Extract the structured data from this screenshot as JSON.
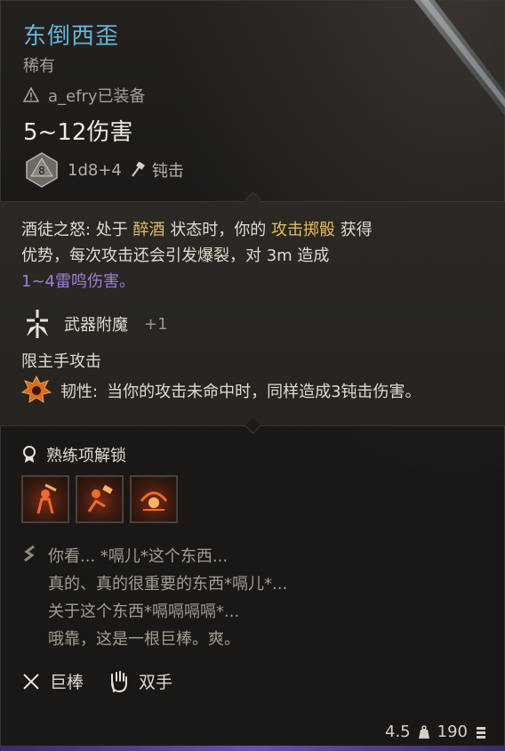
{
  "item": {
    "name": "东倒西歪",
    "rarity": "稀有",
    "equipped_by": "a_efry已装备",
    "damage": "5~12伤害",
    "dice_face": "8",
    "dice_formula": "1d8+4",
    "damage_type": "钝击"
  },
  "effects": {
    "line1_a": "酒徒之怒: 处于 ",
    "line1_b": "醉酒",
    "line1_c": " 状态时，你的 ",
    "line1_d": "攻击掷骰",
    "line1_e": " 获得",
    "line2": "优势，每次攻击还会引发爆裂，对 3m 造成",
    "line3": "1~4雷鸣伤害。",
    "enchant_label": "武器附魔",
    "enchant_value": "+1",
    "mainhand": "限主手攻击",
    "tough_label": "韧性:",
    "tough_text": " 当你的攻击未命中时，同样造成3钝击伤害。"
  },
  "proficiency": {
    "heading": "熟练项解锁",
    "icons": [
      "cleave-skill-icon",
      "pommel-strike-skill-icon",
      "rush-attack-skill-icon"
    ]
  },
  "flavor": {
    "lines": [
      "你看... *嗝儿*这个东西...",
      "真的、真的很重要的东西*嗝儿*...",
      "关于这个东西*嗝嗝嗝嗝*...",
      "哦靠，这是一根巨棒。爽。"
    ]
  },
  "footer": {
    "weapon_type": "巨棒",
    "handedness": "双手",
    "weight": "4.5",
    "price": "190"
  },
  "colors": {
    "title": "#62b6d8",
    "highlight": "#e3bd5c",
    "thunder": "#9d7fd9"
  }
}
